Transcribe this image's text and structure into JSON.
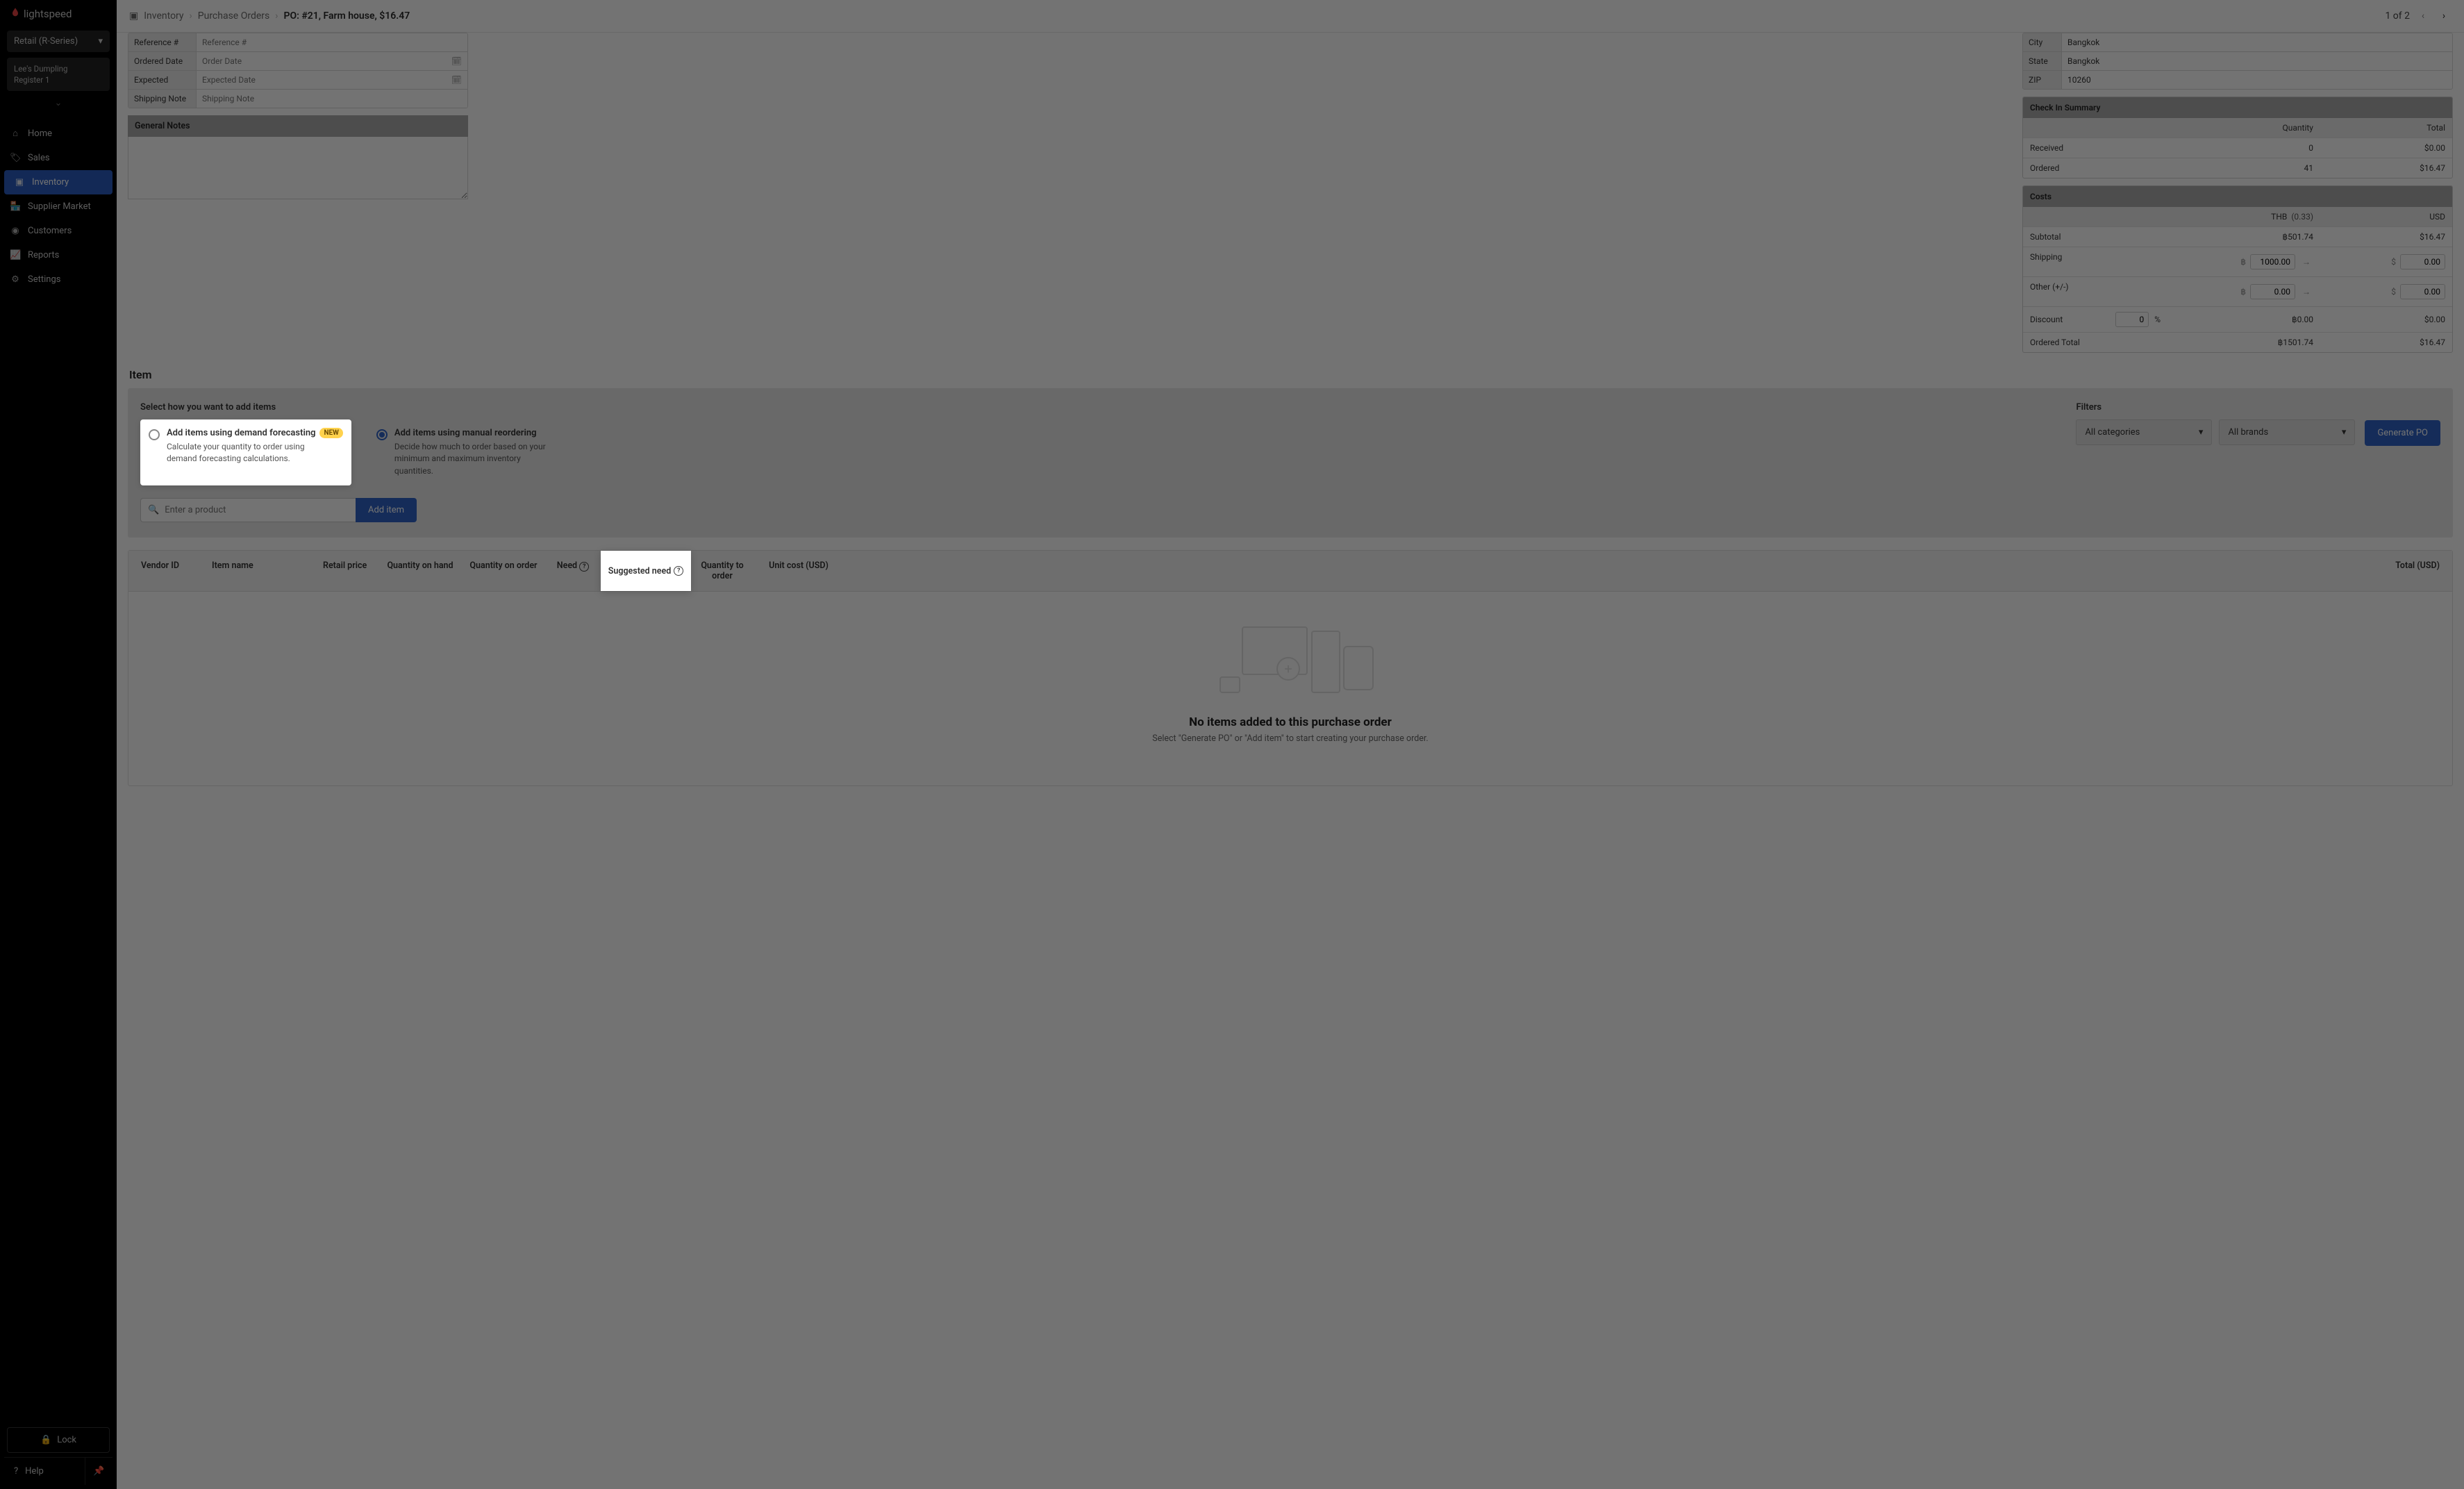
{
  "brand": "lightspeed",
  "retail_selector": "Retail (R-Series)",
  "store": {
    "name": "Lee's Dumpling",
    "register": "Register 1"
  },
  "nav": {
    "home": "Home",
    "sales": "Sales",
    "inventory": "Inventory",
    "supplier": "Supplier Market",
    "customers": "Customers",
    "reports": "Reports",
    "settings": "Settings"
  },
  "footer": {
    "lock": "Lock",
    "help": "Help"
  },
  "breadcrumb": {
    "l1": "Inventory",
    "l2": "Purchase Orders",
    "l3": "PO:  #21, Farm house, $16.47",
    "pager": "1 of 2"
  },
  "po_fields": {
    "reference_label": "Reference #",
    "reference_placeholder": "Reference #",
    "ordered_label": "Ordered Date",
    "ordered_placeholder": "Order Date",
    "expected_label": "Expected",
    "expected_placeholder": "Expected Date",
    "shipnote_label": "Shipping Note",
    "shipnote_placeholder": "Shipping Note",
    "general_notes": "General Notes"
  },
  "address": {
    "city_label": "City",
    "city": "Bangkok",
    "state_label": "State",
    "state": "Bangkok",
    "zip_label": "ZIP",
    "zip": "10260"
  },
  "checkin": {
    "header": "Check In Summary",
    "qty_h": "Quantity",
    "total_h": "Total",
    "received_l": "Received",
    "received_q": "0",
    "received_t": "$0.00",
    "ordered_l": "Ordered",
    "ordered_q": "41",
    "ordered_t": "$16.47"
  },
  "costs": {
    "header": "Costs",
    "thb": "THB",
    "thb_rate": "(0.33)",
    "usd": "USD",
    "subtotal_l": "Subtotal",
    "subtotal_thb": "฿501.74",
    "subtotal_usd": "$16.47",
    "shipping_l": "Shipping",
    "shipping_thb": "1000.00",
    "shipping_usd": "0.00",
    "other_l": "Other (+/-)",
    "other_thb": "0.00",
    "other_usd": "0.00",
    "discount_l": "Discount",
    "discount_v": "0",
    "discount_u": "%",
    "discount_thb": "฿0.00",
    "discount_usd": "$0.00",
    "total_l": "Ordered Total",
    "total_thb": "฿1501.74",
    "total_usd": "$16.47",
    "baht": "฿",
    "dollar": "$",
    "arrow": "→"
  },
  "item_section": {
    "title": "Item",
    "select_label": "Select how you want to add items",
    "forecast_t": "Add items using demand forecasting",
    "forecast_badge": "NEW",
    "forecast_d": "Calculate your quantity to order using demand forecasting calculations.",
    "manual_t": "Add items using manual reordering",
    "manual_d": "Decide how much to order based on your minimum and maximum inventory quantities.",
    "filters_l": "Filters",
    "cat_drop": "All categories",
    "brand_drop": "All brands",
    "generate": "Generate PO",
    "search_placeholder": "Enter a product",
    "add_item": "Add item"
  },
  "table": {
    "vendor": "Vendor ID",
    "name": "Item name",
    "retail": "Retail price",
    "qoh": "Quantity on hand",
    "qoo": "Quantity on order",
    "need": "Need",
    "sugg": "Suggested need",
    "qto": "Quantity to order",
    "unit": "Unit cost (USD)",
    "total": "Total (USD)"
  },
  "empty": {
    "title": "No items added to this purchase order",
    "sub": "Select \"Generate PO\" or \"Add item\" to start creating your purchase order."
  }
}
